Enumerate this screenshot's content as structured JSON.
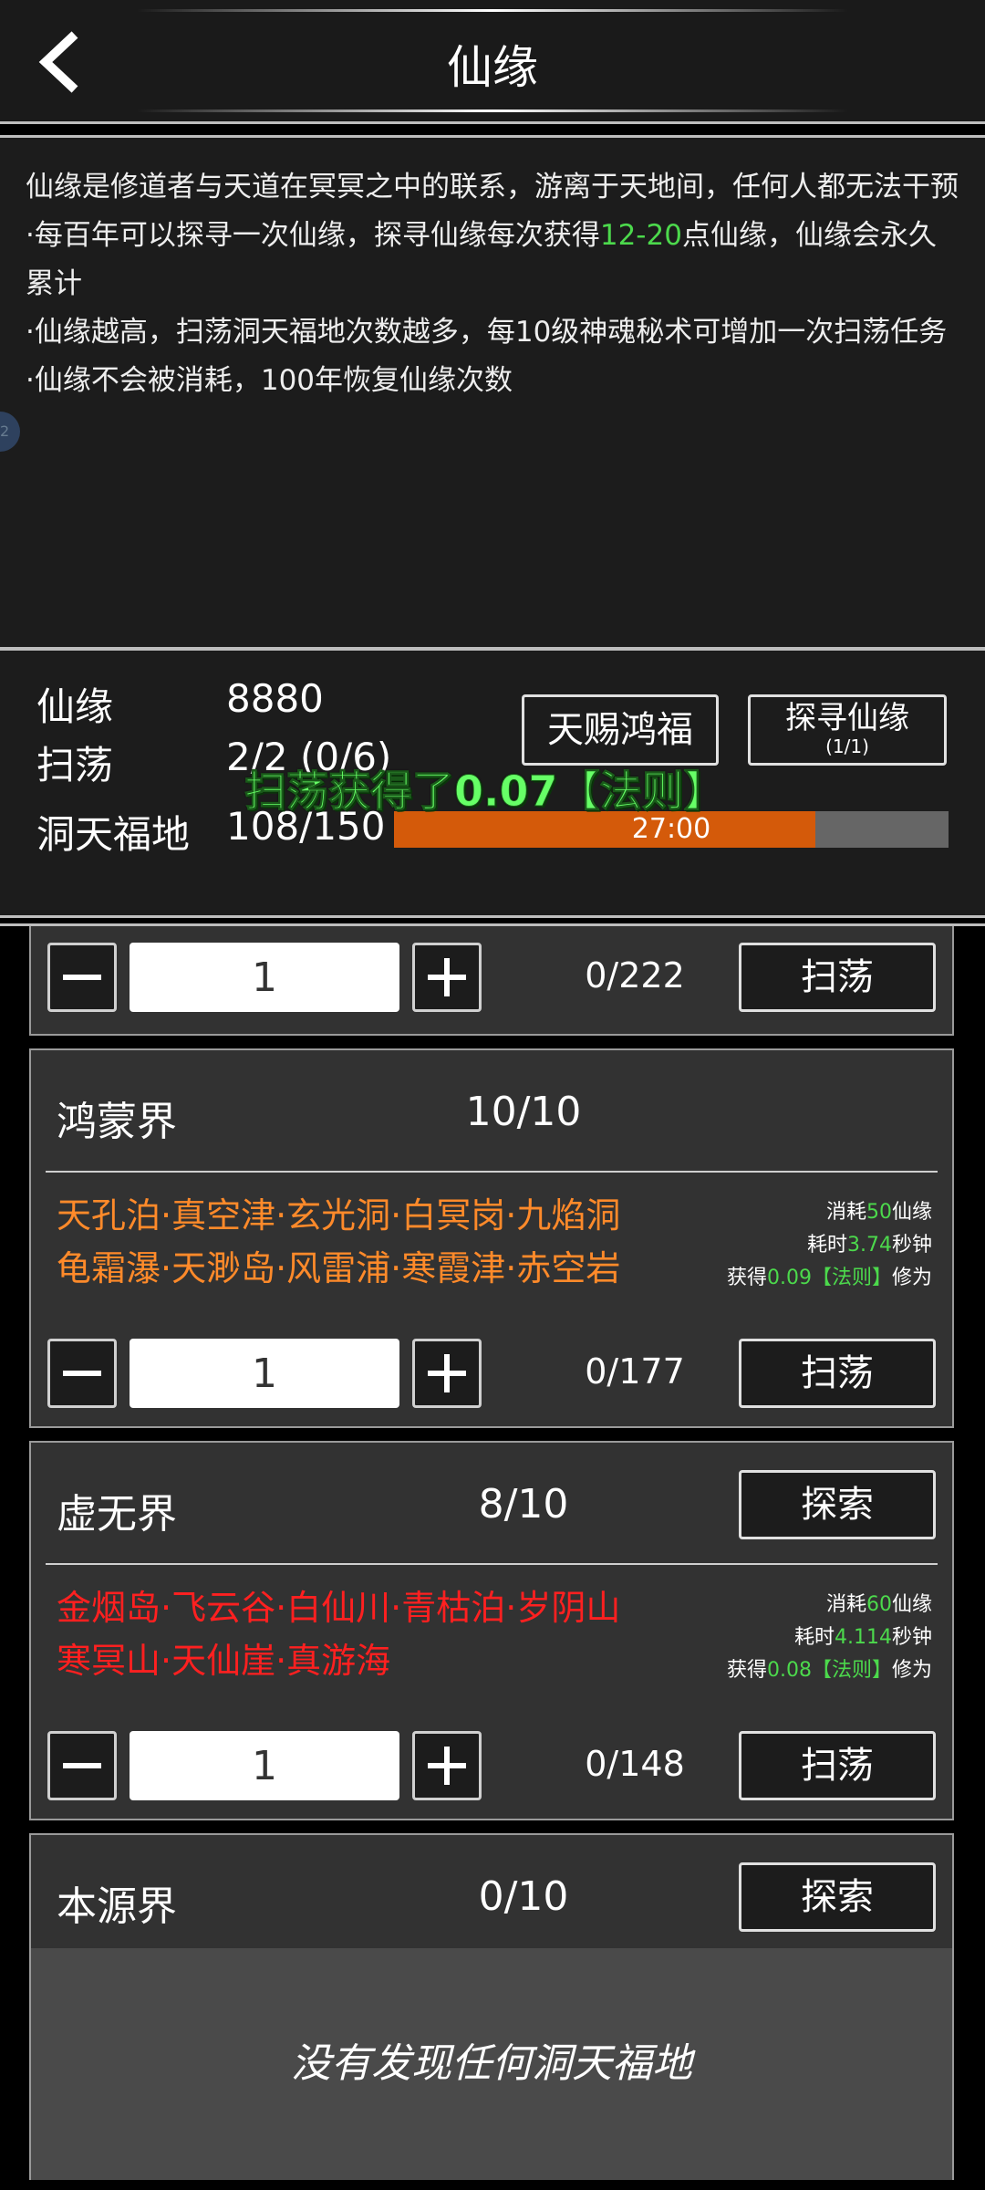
{
  "header": {
    "title": "仙缘"
  },
  "description": {
    "line1": "仙缘是修道者与天道在冥冥之中的联系，游离于天地间，任何人都无法干预",
    "line2_pre": "·每百年可以探寻一次仙缘，探寻仙缘每次获得",
    "line2_range": "12-20",
    "line2_post": "点仙缘，仙缘会永久累计",
    "line3": "·仙缘越高，扫荡洞天福地次数越多，每10级神魂秘术可增加一次扫荡任务",
    "line4": "·仙缘不会被消耗，100年恢复仙缘次数"
  },
  "stats": {
    "xianyuan_label": "仙缘",
    "xianyuan_value": "8880",
    "sweep_label": "扫荡",
    "sweep_value": "2/2 (0/6)",
    "dongtian_label": "洞天福地",
    "dongtian_value": "108/150",
    "bless_button": "天赐鸿福",
    "seek_button": "探寻仙缘",
    "seek_sub": "(1/1)",
    "timer": "27:00",
    "timer_progress": 0.76,
    "toast": "扫荡获得了0.07【法则】"
  },
  "realms": {
    "first": {
      "qty": "1",
      "progress": "0/222",
      "sweep_label": "扫荡"
    },
    "hongmeng": {
      "name": "鸿蒙界",
      "count": "10/10",
      "places_line1": "天孔泊·真空津·玄光洞·白冥岗·九焰洞",
      "places_line2": "龟霜瀑·天渺岛·风雷浦·寒霞津·赤空岩",
      "places_color": "#ff8a2a",
      "cost_pre": "消耗",
      "cost_val": "50",
      "cost_post": "仙缘",
      "time_pre": "耗时",
      "time_val": "3.74",
      "time_post": "秒钟",
      "gain_pre": "获得",
      "gain_val": "0.09【法则】",
      "gain_post": "修为",
      "qty": "1",
      "progress": "0/177",
      "sweep_label": "扫荡"
    },
    "xuwu": {
      "name": "虚无界",
      "count": "8/10",
      "explore_label": "探索",
      "places_line1": "金烟岛·飞云谷·白仙川·青枯泊·岁阴山",
      "places_line2": "寒冥山·天仙崖·真游海",
      "places_color": "#ff2020",
      "cost_pre": "消耗",
      "cost_val": "60",
      "cost_post": "仙缘",
      "time_pre": "耗时",
      "time_val": "4.114",
      "time_post": "秒钟",
      "gain_pre": "获得",
      "gain_val": "0.08【法则】",
      "gain_post": "修为",
      "qty": "1",
      "progress": "0/148",
      "sweep_label": "扫荡"
    },
    "benyuan": {
      "name": "本源界",
      "count": "0/10",
      "explore_label": "探索",
      "empty_text": "没有发现任何洞天福地"
    }
  },
  "icons": {
    "back": "chevron-left-icon",
    "minus": "minus-icon",
    "plus": "plus-icon"
  },
  "colors": {
    "accent_green": "#4cd94c",
    "bar_orange": "#d45a0a"
  }
}
